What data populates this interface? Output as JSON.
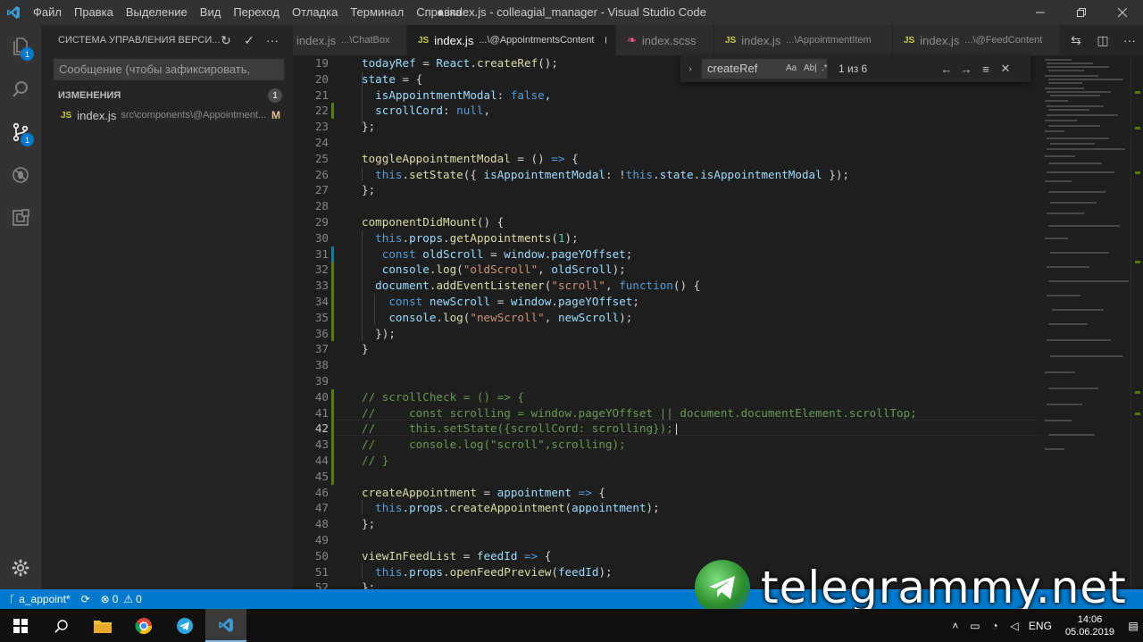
{
  "window": {
    "title": "● index.js - colleagial_manager - Visual Studio Code",
    "menu": [
      "Файл",
      "Правка",
      "Выделение",
      "Вид",
      "Переход",
      "Отладка",
      "Терминал",
      "Справка"
    ]
  },
  "activity": {
    "explorer_badge": "1",
    "scm_badge": "1"
  },
  "sidebar": {
    "title": "СИСТЕМА УПРАВЛЕНИЯ ВЕРСИ...",
    "commit_placeholder": "Сообщение (чтобы зафиксировать,",
    "changes_label": "ИЗМЕНЕНИЯ",
    "changes_count": "1",
    "file_name": "index.js",
    "file_path": "src\\components\\@Appointment...",
    "file_status": "M"
  },
  "tabs": [
    {
      "name": "index.js",
      "desc": "...\\ChatBox"
    },
    {
      "name": "index.js",
      "desc": "...\\@AppointmentsContent"
    },
    {
      "name": "index.scss",
      "desc": ""
    },
    {
      "name": "index.js",
      "desc": "...\\AppointmentItem"
    },
    {
      "name": "index.js",
      "desc": "...\\@FeedContent"
    }
  ],
  "find": {
    "query": "createRef",
    "case_label": "Aa",
    "word_label": "Ab|",
    "regex_label": ".*",
    "count": "1 из 6"
  },
  "editor": {
    "line_numbers": [
      "19",
      "20",
      "21",
      "22",
      "23",
      "24",
      "25",
      "26",
      "27",
      "28",
      "29",
      "30",
      "31",
      "32",
      "33",
      "34",
      "35",
      "36",
      "37",
      "38",
      "39",
      "40",
      "41",
      "42",
      "43",
      "44",
      "45",
      "46",
      "47",
      "48",
      "49",
      "50",
      "51",
      "52"
    ],
    "current_line": "42"
  },
  "status": {
    "branch": "a_appoint*",
    "errors": "0",
    "warnings": "0"
  },
  "watermark": "telegrammy.net",
  "taskbar": {
    "lang": "ENG",
    "time": "14:06",
    "date": "05.06.2019"
  }
}
